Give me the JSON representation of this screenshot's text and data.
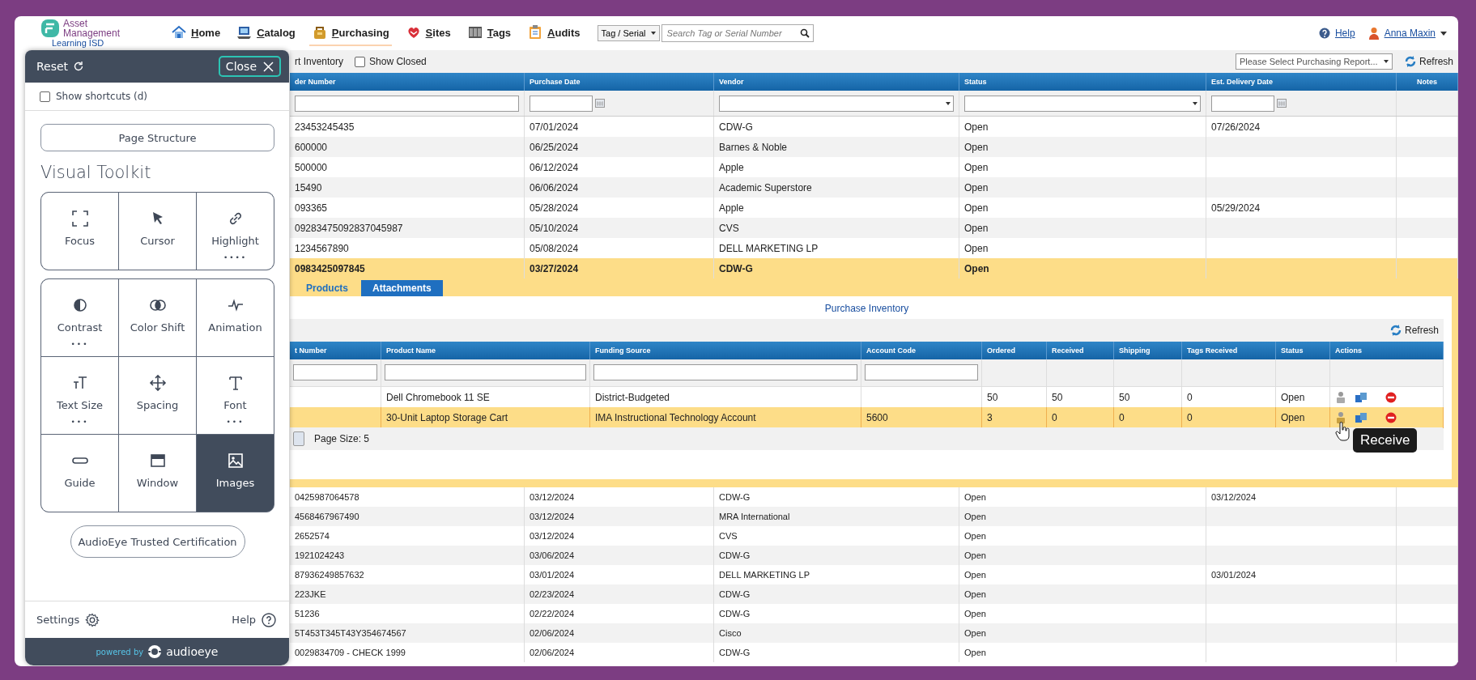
{
  "brand": {
    "logo_text": "Asset Management",
    "org": "Learning ISD"
  },
  "nav": {
    "items": [
      {
        "kind": "home",
        "label": "Home",
        "selected": false
      },
      {
        "kind": "catalog",
        "label": "Catalog",
        "selected": false
      },
      {
        "kind": "purchasing",
        "label": "Purchasing",
        "selected": true
      },
      {
        "kind": "sites",
        "label": "Sites",
        "selected": false
      },
      {
        "kind": "tags",
        "label": "Tags",
        "selected": false
      },
      {
        "kind": "audits",
        "label": "Audits",
        "selected": false
      }
    ],
    "search": {
      "type_select": "Tag / Serial",
      "placeholder": "Search Tag or Serial Number"
    },
    "help": "Help",
    "user": "Anna Maxin"
  },
  "toolbar": {
    "import_link": "rt Inventory",
    "show_closed": {
      "label": "Show Closed",
      "checked": false
    },
    "report_select": "Please Select Purchasing Report...",
    "refresh": "Refresh"
  },
  "orders": {
    "columns": [
      "der Number",
      "Purchase Date",
      "Vendor",
      "Status",
      "Est. Delivery Date",
      "Notes"
    ],
    "rows_before": [
      {
        "order": "23453245435",
        "date": "07/01/2024",
        "vendor": "CDW-G",
        "status": "Open",
        "delivery": "07/26/2024",
        "selected": false
      },
      {
        "order": "600000",
        "date": "06/25/2024",
        "vendor": "Barnes & Noble",
        "status": "Open",
        "selected": false
      },
      {
        "order": "500000",
        "date": "06/12/2024",
        "vendor": "Apple",
        "status": "Open",
        "selected": false
      },
      {
        "order": "15490",
        "date": "06/06/2024",
        "vendor": "Academic Superstore",
        "status": "Open",
        "selected": false
      },
      {
        "order": "093365",
        "date": "05/28/2024",
        "vendor": "Apple",
        "status": "Open",
        "delivery": "05/29/2024",
        "selected": false
      },
      {
        "order": "09283475092837045987",
        "date": "05/10/2024",
        "vendor": "CVS",
        "status": "Open",
        "selected": false
      },
      {
        "order": "1234567890",
        "date": "05/08/2024",
        "vendor": "DELL MARKETING LP",
        "status": "Open",
        "selected": false
      },
      {
        "order": "0983425097845",
        "date": "03/27/2024",
        "vendor": "CDW-G",
        "status": "Open",
        "selected": true
      }
    ],
    "detail": {
      "tabs": [
        {
          "label": "Products",
          "selected": true
        },
        {
          "label": "Attachments",
          "selected": false
        }
      ],
      "title": "Purchase Inventory",
      "refresh": "Refresh",
      "columns": [
        "t Number",
        "Product Name",
        "Funding Source",
        "Account Code",
        "Ordered",
        "Received",
        "Shipping",
        "Tags Received",
        "Status",
        "Actions"
      ],
      "rows": [
        {
          "product": "Dell Chromebook 11 SE",
          "funding": "District-Budgeted",
          "ordered": "50",
          "received": "50",
          "shipping": "50",
          "tags_received": "0",
          "status": "Open",
          "selected": false
        },
        {
          "product": "30-Unit Laptop Storage Cart",
          "funding": "IMA Instructional Technology Account",
          "account": "5600",
          "ordered": "3",
          "received": "0",
          "shipping": "0",
          "tags_received": "0",
          "status": "Open",
          "selected": true
        }
      ],
      "page_size": "Page Size: 5",
      "tooltip": "Receive"
    },
    "rows_after": [
      {
        "order": "0425987064578",
        "date": "03/12/2024",
        "vendor": "CDW-G",
        "status": "Open",
        "delivery": "03/12/2024",
        "selected": false
      },
      {
        "order": "4568467967490",
        "date": "03/12/2024",
        "vendor": "MRA International",
        "status": "Open",
        "selected": false
      },
      {
        "order": "2652574",
        "date": "03/12/2024",
        "vendor": "CVS",
        "status": "Open",
        "selected": false
      },
      {
        "order": "1921024243",
        "date": "03/06/2024",
        "vendor": "CDW-G",
        "status": "Open",
        "selected": false
      },
      {
        "order": "87936249857632",
        "date": "03/01/2024",
        "vendor": "DELL MARKETING LP",
        "status": "Open",
        "delivery": "03/01/2024",
        "selected": false
      },
      {
        "order": "223JKE",
        "date": "02/23/2024",
        "vendor": "CDW-G",
        "status": "Open",
        "selected": false
      },
      {
        "order": "51236",
        "date": "02/22/2024",
        "vendor": "CDW-G",
        "status": "Open",
        "selected": false
      },
      {
        "order": "5T453T345T43Y354674567",
        "date": "02/06/2024",
        "vendor": "Cisco",
        "status": "Open",
        "selected": false
      },
      {
        "order": "0029834709 - CHECK 1999",
        "date": "02/06/2024",
        "vendor": "CDW-G",
        "status": "Open",
        "selected": false
      }
    ]
  },
  "toolkit": {
    "reset": "Reset",
    "close": "Close",
    "shortcuts": {
      "label": "Show shortcuts (d)",
      "checked": false
    },
    "page_structure": "Page Structure",
    "heading": "Visual Toolkit",
    "groups": [
      [
        {
          "kind": "focus",
          "label": "Focus",
          "selected": false
        },
        {
          "kind": "cursor",
          "label": "Cursor",
          "selected": false
        },
        {
          "kind": "highlight",
          "label": "Highlight",
          "dots": "••••",
          "selected": false
        }
      ],
      [
        {
          "kind": "contrast",
          "label": "Contrast",
          "dots": "•••",
          "selected": false
        },
        {
          "kind": "colorshift",
          "label": "Color Shift",
          "selected": false
        },
        {
          "kind": "animation",
          "label": "Animation",
          "selected": false
        },
        {
          "kind": "textsize",
          "label": "Text Size",
          "dots": "•••",
          "selected": false
        },
        {
          "kind": "spacing",
          "label": "Spacing",
          "selected": false
        },
        {
          "kind": "font",
          "label": "Font",
          "dots": "•••",
          "selected": false
        },
        {
          "kind": "guide",
          "label": "Guide",
          "selected": false
        },
        {
          "kind": "window",
          "label": "Window",
          "selected": false
        },
        {
          "kind": "images",
          "label": "Images",
          "selected": true
        }
      ]
    ],
    "certification": "AudioEye Trusted Certification",
    "settings": "Settings",
    "help": "Help",
    "powered_by": "powered by",
    "brand": "audioeye"
  }
}
